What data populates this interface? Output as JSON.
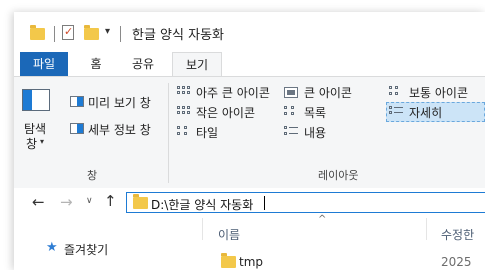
{
  "window": {
    "title": "한글 양식 자동화"
  },
  "tabs": [
    {
      "label": "파일"
    },
    {
      "label": "홈"
    },
    {
      "label": "공유"
    },
    {
      "label": "보기"
    }
  ],
  "ribbon": {
    "pane_group": {
      "nav_pane_label_1": "탐색",
      "nav_pane_label_2": "창",
      "preview_pane": "미리 보기 창",
      "details_pane": "세부 정보 창",
      "group_label": "창"
    },
    "layout_group": {
      "items": [
        {
          "label": "아주 큰 아이콘"
        },
        {
          "label": "큰 아이콘"
        },
        {
          "label": "보통 아이콘"
        },
        {
          "label": "작은 아이콘"
        },
        {
          "label": "목록"
        },
        {
          "label": "자세히"
        },
        {
          "label": "타일"
        },
        {
          "label": "내용"
        }
      ],
      "group_label": "레이아웃"
    }
  },
  "address": {
    "path": "D:\\한글 양식 자동화"
  },
  "nav_pane": {
    "quick_access": "즐겨찾기"
  },
  "file_list": {
    "columns": [
      {
        "label": "이름"
      },
      {
        "label": "수정한"
      }
    ],
    "rows": [
      {
        "name": "tmp",
        "modified": "2025"
      }
    ]
  },
  "colors": {
    "file_tab": "#1b68b8",
    "selection": "#cce4f7",
    "address_border": "#1e7bd4",
    "folder": "#f3c84a"
  }
}
